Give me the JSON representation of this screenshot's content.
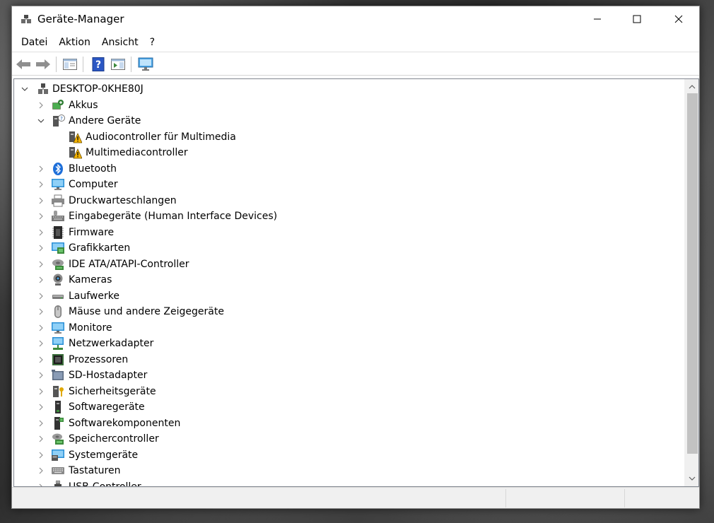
{
  "window": {
    "title": "Geräte-Manager"
  },
  "menu": [
    "Datei",
    "Aktion",
    "Ansicht",
    "?"
  ],
  "toolbar": [
    {
      "name": "back-button",
      "icon": "arrow-left-icon"
    },
    {
      "name": "forward-button",
      "icon": "arrow-right-icon"
    },
    {
      "name": "show-hide-console-tree-button",
      "icon": "console-tree-icon"
    },
    {
      "name": "help-button",
      "icon": "help-icon"
    },
    {
      "name": "show-action-pane-button",
      "icon": "action-pane-icon"
    },
    {
      "name": "scan-hardware-button",
      "icon": "monitor-scan-icon"
    }
  ],
  "tree": {
    "root": "DESKTOP-0KHE80J",
    "items": [
      {
        "label": "Akkus",
        "icon": "battery-icon",
        "expanded": false
      },
      {
        "label": "Andere Geräte",
        "icon": "unknown-device-icon",
        "expanded": true,
        "children": [
          {
            "label": "Audiocontroller für Multimedia",
            "icon": "warning-device-icon"
          },
          {
            "label": "Multimediacontroller",
            "icon": "warning-device-icon"
          }
        ]
      },
      {
        "label": "Bluetooth",
        "icon": "bluetooth-icon",
        "expanded": false
      },
      {
        "label": "Computer",
        "icon": "computer-icon",
        "expanded": false
      },
      {
        "label": "Druckwarteschlangen",
        "icon": "printer-icon",
        "expanded": false
      },
      {
        "label": "Eingabegeräte (Human Interface Devices)",
        "icon": "hid-icon",
        "expanded": false
      },
      {
        "label": "Firmware",
        "icon": "firmware-icon",
        "expanded": false
      },
      {
        "label": "Grafikkarten",
        "icon": "display-adapter-icon",
        "expanded": false
      },
      {
        "label": "IDE ATA/ATAPI-Controller",
        "icon": "ide-controller-icon",
        "expanded": false
      },
      {
        "label": "Kameras",
        "icon": "camera-icon",
        "expanded": false
      },
      {
        "label": "Laufwerke",
        "icon": "disk-drive-icon",
        "expanded": false
      },
      {
        "label": "Mäuse und andere Zeigegeräte",
        "icon": "mouse-icon",
        "expanded": false
      },
      {
        "label": "Monitore",
        "icon": "monitor-icon",
        "expanded": false
      },
      {
        "label": "Netzwerkadapter",
        "icon": "network-adapter-icon",
        "expanded": false
      },
      {
        "label": "Prozessoren",
        "icon": "processor-icon",
        "expanded": false
      },
      {
        "label": "SD-Hostadapter",
        "icon": "sd-host-icon",
        "expanded": false
      },
      {
        "label": "Sicherheitsgeräte",
        "icon": "security-device-icon",
        "expanded": false
      },
      {
        "label": "Softwaregeräte",
        "icon": "software-device-icon",
        "expanded": false
      },
      {
        "label": "Softwarekomponenten",
        "icon": "software-component-icon",
        "expanded": false
      },
      {
        "label": "Speichercontroller",
        "icon": "storage-controller-icon",
        "expanded": false
      },
      {
        "label": "Systemgeräte",
        "icon": "system-device-icon",
        "expanded": false
      },
      {
        "label": "Tastaturen",
        "icon": "keyboard-icon",
        "expanded": false
      },
      {
        "label": "USB-Controller",
        "icon": "usb-icon",
        "expanded": false
      }
    ]
  },
  "colors": {
    "accent": "#1e90ff",
    "warning": "#f5b400",
    "scrollbar": "#c2c2c2"
  }
}
